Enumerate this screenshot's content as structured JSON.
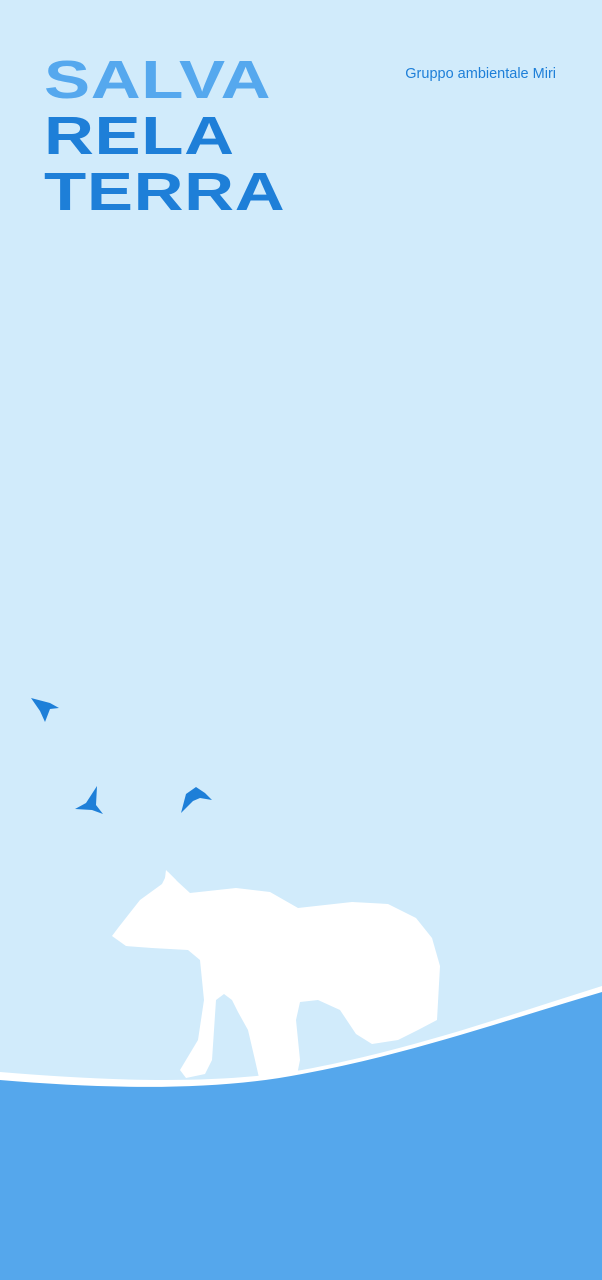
{
  "poster": {
    "title_lines": [
      "SALVA",
      "RELA",
      "TERRA"
    ],
    "organization": "Gruppo ambientale Miri"
  },
  "colors": {
    "sky": "#d1ebfb",
    "title_light": "#55a8ee",
    "title_dark": "#1e7fd8",
    "ground": "#55a7ec",
    "bear": "#ffffff",
    "birds": "#1e7fd8"
  },
  "illustration": {
    "icons": [
      "polar-bear-icon",
      "bird-icon",
      "bird-icon",
      "bird-icon",
      "hill-shape"
    ]
  }
}
